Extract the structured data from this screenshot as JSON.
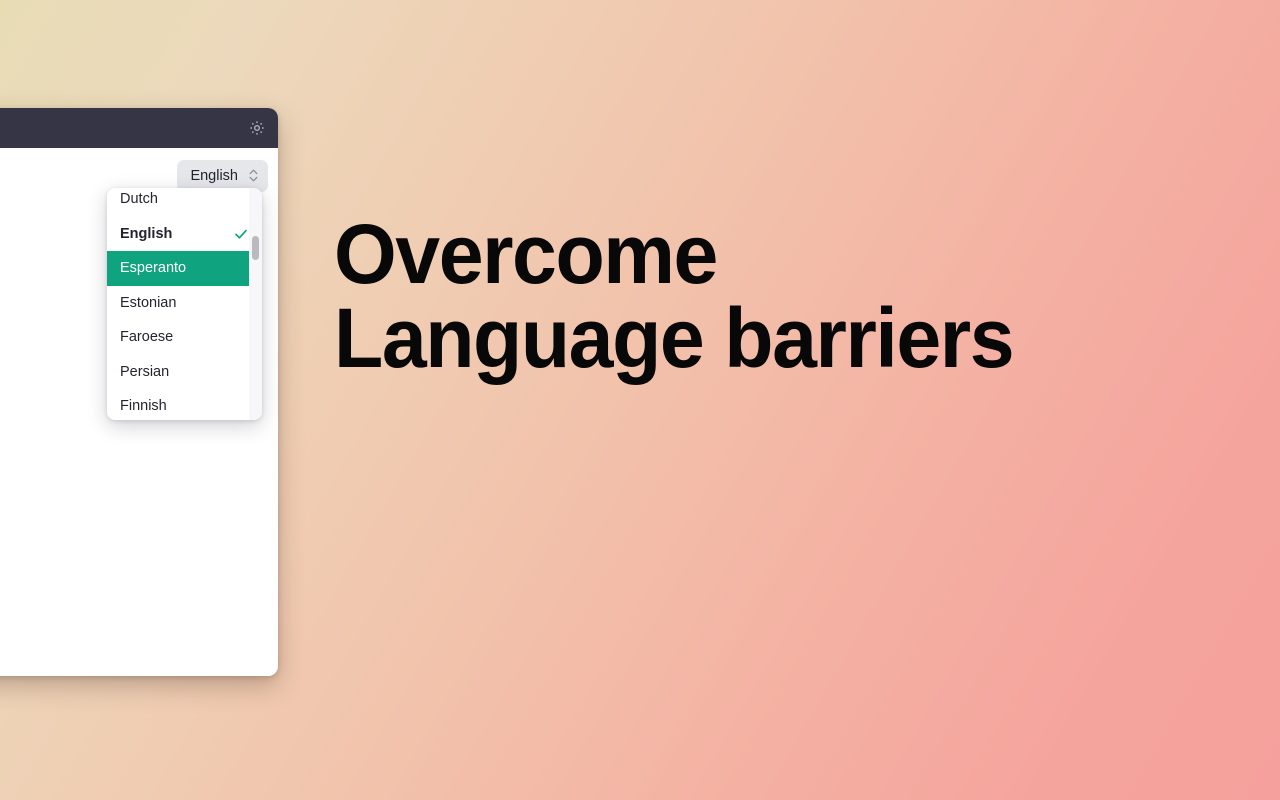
{
  "page": {
    "hero_line_1": "Overcome",
    "hero_line_2": "Language barriers",
    "background_gradient_from": "#e8dcb5",
    "background_gradient_to": "#f5a09c"
  },
  "app": {
    "titlebar": {
      "background_color": "#353545",
      "settings_icon": "gear-icon"
    },
    "toolbar": {
      "language_select_value": "English",
      "language_select_background": "#e6e7eb",
      "stepper_icon": "chevron-up-down-icon"
    }
  },
  "dropdown": {
    "highlight_color": "#10a37f",
    "check_color": "#10a37f",
    "selected_value": "English",
    "highlighted_value": "Esperanto",
    "items": [
      {
        "label": "Dutch",
        "selected": false,
        "highlighted": false
      },
      {
        "label": "English",
        "selected": true,
        "highlighted": false
      },
      {
        "label": "Esperanto",
        "selected": false,
        "highlighted": true
      },
      {
        "label": "Estonian",
        "selected": false,
        "highlighted": false
      },
      {
        "label": "Faroese",
        "selected": false,
        "highlighted": false
      },
      {
        "label": "Persian",
        "selected": false,
        "highlighted": false
      },
      {
        "label": "Finnish",
        "selected": false,
        "highlighted": false
      }
    ]
  }
}
